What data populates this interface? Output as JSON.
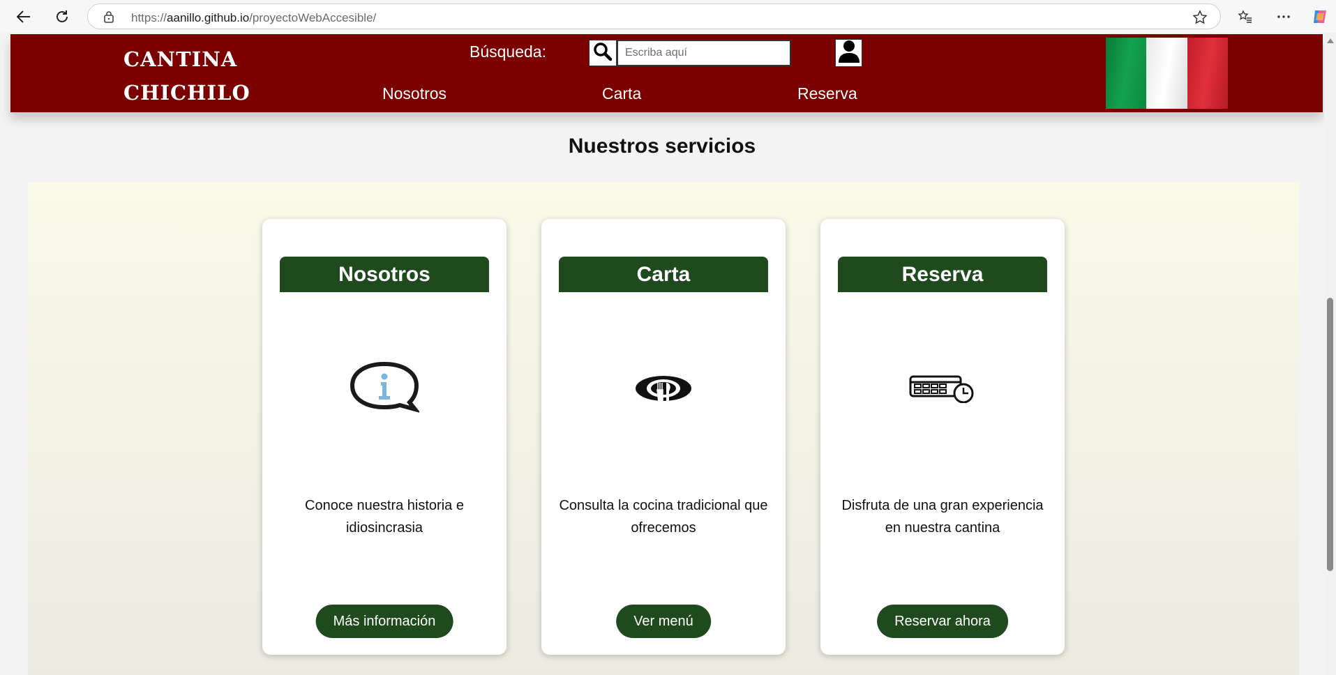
{
  "browser": {
    "url_prefix": "https://",
    "url_host": "aanillo.github.io",
    "url_path": "/proyectoWebAccesible/"
  },
  "header": {
    "logo_line1": "CANTINA",
    "logo_line2": "CHICHILO",
    "search_label": "Búsqueda:",
    "search_placeholder": "Escriba aquí",
    "nav": [
      "Nosotros",
      "Carta",
      "Reserva"
    ],
    "colors": {
      "header_bg": "#7b0000",
      "flag": [
        "#0f9244",
        "#ffffff",
        "#d1242f"
      ]
    }
  },
  "services": {
    "title": "Nuestros servicios",
    "cards": [
      {
        "title": "Nosotros",
        "icon": "info-speech-bubble-icon",
        "text": "Conoce nuestra historia e idiosincrasia",
        "button": "Más información"
      },
      {
        "title": "Carta",
        "icon": "dish-cutlery-icon",
        "text": "Consulta la cocina tradicional que ofrecemos",
        "button": "Ver menú"
      },
      {
        "title": "Reserva",
        "icon": "calendar-clock-icon",
        "text": "Disfruta de una gran experiencia en nuestra cantina",
        "button": "Reservar ahora"
      }
    ],
    "colors": {
      "accent": "#1f4a1e"
    }
  }
}
